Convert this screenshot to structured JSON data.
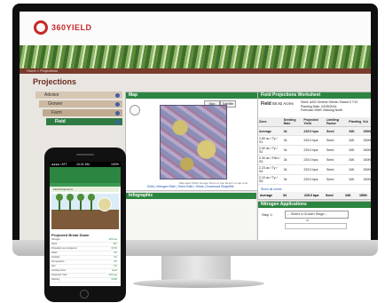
{
  "brand": {
    "name_a": "360",
    "name_b": "YIELD",
    "sub": "CENTER"
  },
  "nav": {
    "text": "Home > Projections"
  },
  "page": {
    "title": "Projections"
  },
  "tree": {
    "advisor": "Advisor",
    "grower": "Grower",
    "farm": "Farm",
    "field": "Field"
  },
  "map": {
    "title": "Map",
    "btn_map": "Map",
    "btn_satellite": "Satellite",
    "footer": "Map data ©2014 Google   Terms of Use   Report a map error",
    "links": "Soils | Nitrogen Rate | Seed Rate | Yields | Download Shapefile"
  },
  "infographic": {
    "title": "Infographic"
  },
  "worksheet": {
    "title": "Field Projections Worksheet",
    "field_label": "Field",
    "field_acres": "58.92 Acres",
    "seed": "Seed: AAG Generic Seeds / Brand X Y10",
    "planting_date": "Planting Date: 04/28/2014",
    "forecast": "Forecast: NWS Vicksing North",
    "headers": [
      "Zone",
      "Seeding Rate",
      "Projected Yield",
      "Limiting Factor",
      "Planting",
      "N-k"
    ],
    "rows": [
      {
        "zone": "Average",
        "seeding": "34",
        "yield": "225.0 bpa",
        "factor": "Seed",
        "planting": "34K",
        "nk": "150N",
        "avg": true
      },
      {
        "zone": "2.80 ac / Ty / S1",
        "seeding": "34",
        "yield": "225.0 bpa",
        "factor": "Seed",
        "planting": "34K",
        "nk": "150N",
        "avg": false
      },
      {
        "zone": "2.52 ac / Ty / S2",
        "seeding": "34",
        "yield": "225.0 bpa",
        "factor": "Seed",
        "planting": "34K",
        "nk": "150N",
        "avg": false
      },
      {
        "zone": "2.30 ac / Fish / S3",
        "seeding": "34",
        "yield": "225.0 bpa",
        "factor": "Seed",
        "planting": "34K",
        "nk": "150N",
        "avg": false
      },
      {
        "zone": "2.23 ac / Ty / S4",
        "seeding": "34",
        "yield": "225.0 bpa",
        "factor": "Seed",
        "planting": "34K",
        "nk": "150N",
        "avg": false
      },
      {
        "zone": "2.10 ac / Ty / S5",
        "seeding": "34",
        "yield": "225.0 bpa",
        "factor": "Seed",
        "planting": "34K",
        "nk": "150N",
        "avg": false
      }
    ],
    "show_all": "Show all zones",
    "bottom_avg": {
      "zone": "Average",
      "seeding": "34",
      "yield": "225.0 bpa",
      "factor": "Seed",
      "planting": "34K",
      "nk": "150N"
    }
  },
  "nitrogen": {
    "title": "Nitrogen Applications",
    "step": "Step 1:",
    "select": "-- Select a Growth Stage --",
    "or": "or"
  },
  "phone": {
    "carrier": "●●●●○ ATT",
    "time": "10:21 AM",
    "battery": "100%",
    "banner": "Field Projections",
    "ph_title": "Projected Break Down",
    "rows": [
      {
        "k": "Nitrogen",
        "v": "225 bpa"
      },
      {
        "k": "Seed",
        "v": "34K"
      },
      {
        "k": "Population at emergence",
        "v": "33.5K"
      },
      {
        "k": "Water",
        "v": "OK"
      },
      {
        "k": "Sunlight",
        "v": "OK"
      },
      {
        "k": "Temperature",
        "v": "OK"
      },
      {
        "k": "Soil",
        "v": "OK"
      },
      {
        "k": "Limiting factor",
        "v": "Seed"
      },
      {
        "k": "Projected Yield",
        "v": "225 bpa"
      },
      {
        "k": "Planting",
        "v": "04/28"
      }
    ]
  },
  "colors": {
    "brand_red": "#c62828",
    "panel_green": "#2c8540",
    "nav_brown": "#7a3b2d"
  }
}
